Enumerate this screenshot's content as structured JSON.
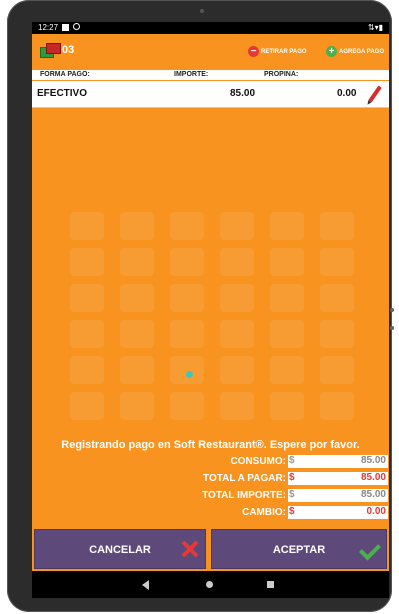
{
  "status": {
    "time": "12:27"
  },
  "header": {
    "number": "03",
    "remove_label": "RETIRAR PAGO",
    "add_label": "AGREGA PAGO"
  },
  "columns": {
    "method": "FORMA PAGO:",
    "amount": "IMPORTE:",
    "tip": "PROPINA:"
  },
  "payment": {
    "method": "EFECTIVO",
    "amount": "85.00",
    "tip": "0.00"
  },
  "message": "Registrando pago en Soft Restaurant®. Espere por favor.",
  "totals": {
    "consumo_label": "CONSUMO:",
    "consumo_cur": "$",
    "consumo_val": "85.00",
    "total_pagar_label": "TOTAL A PAGAR:",
    "total_pagar_cur": "$",
    "total_pagar_val": "85.00",
    "total_importe_label": "TOTAL IMPORTE:",
    "total_importe_cur": "$",
    "total_importe_val": "85.00",
    "cambio_label": "CAMBIO:",
    "cambio_cur": "$",
    "cambio_val": "0.00"
  },
  "buttons": {
    "cancel": "CANCELAR",
    "accept": "ACEPTAR"
  },
  "colors": {
    "accent": "#f7931e",
    "button": "#5e4a7a",
    "danger": "#e53935",
    "success": "#4caf50"
  }
}
